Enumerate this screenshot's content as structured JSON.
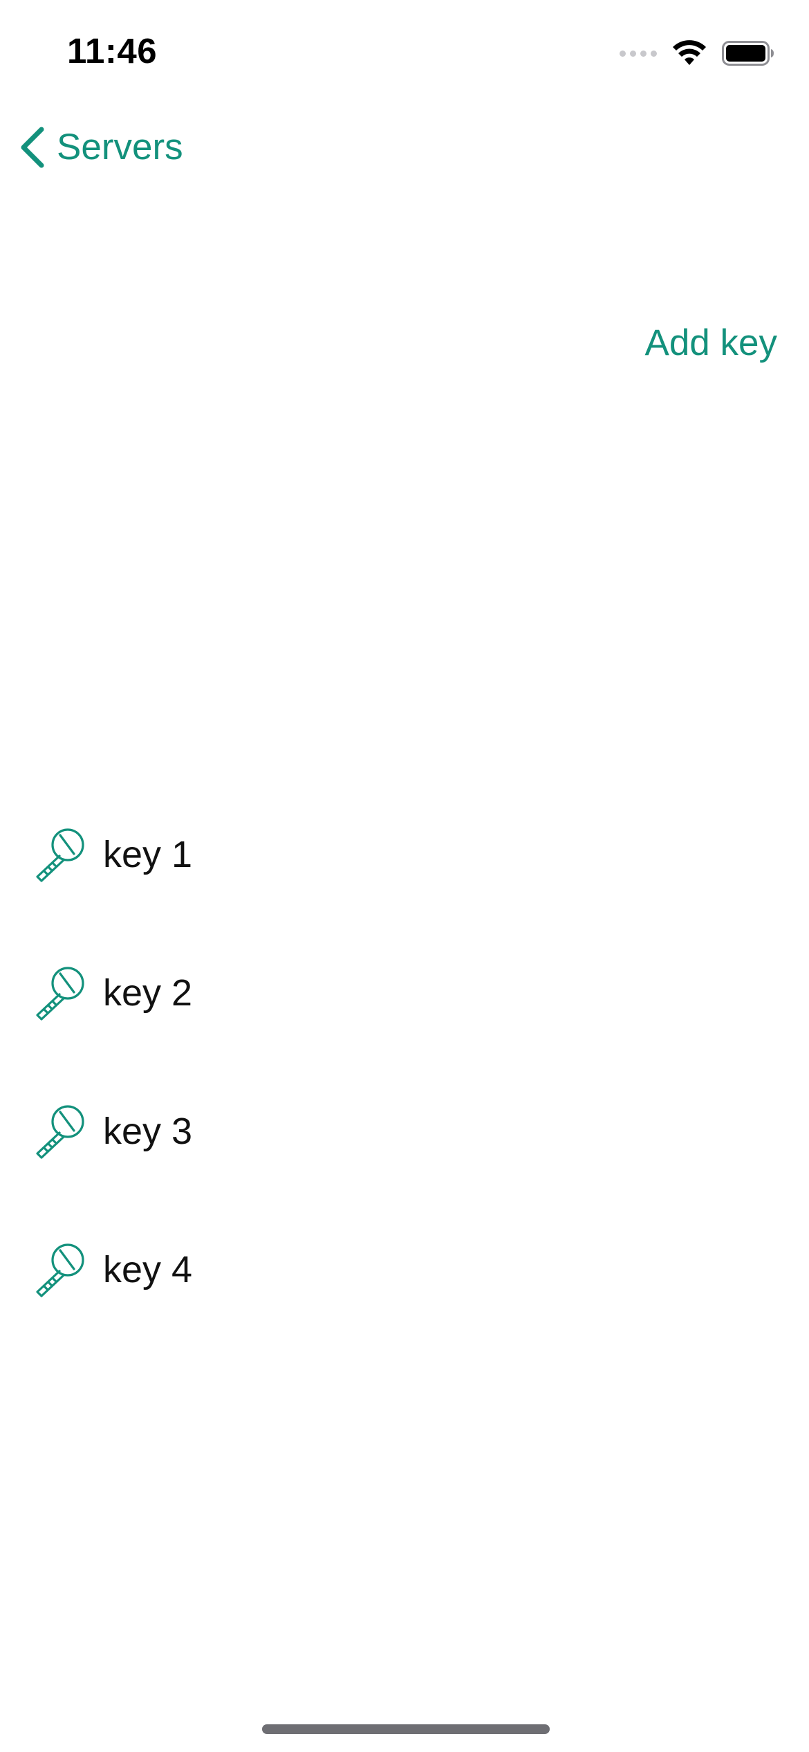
{
  "status_bar": {
    "time": "11:46"
  },
  "nav": {
    "back_label": "Servers"
  },
  "actions": {
    "add_key_label": "Add key"
  },
  "keys": [
    {
      "label": "key 1",
      "icon": "key-icon"
    },
    {
      "label": "key 2",
      "icon": "key-icon"
    },
    {
      "label": "key 3",
      "icon": "key-icon"
    },
    {
      "label": "key 4",
      "icon": "key-icon"
    }
  ],
  "colors": {
    "accent": "#13917c",
    "text": "#111111",
    "background": "#ffffff"
  }
}
